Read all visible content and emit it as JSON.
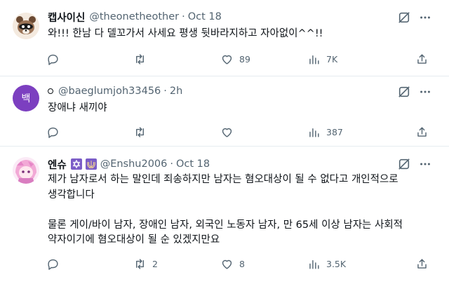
{
  "tweets": [
    {
      "name": "캡사이신",
      "handle": "@theonetheother",
      "dot": "·",
      "time": "Oct 18",
      "text": "와!!! 한남 다 델꼬가서 사세요 평생 뒷바라지하고 자아없이^^!!",
      "replies": "",
      "retweets": "",
      "likes": "89",
      "views": "7K"
    },
    {
      "name": "",
      "avatar_letter": "백",
      "avatar_color": "#7c3fc0",
      "handle": "@baeglumjoh33456",
      "dot": "·",
      "time": "2h",
      "text": "장애냐 새끼야",
      "replies": "",
      "retweets": "",
      "likes": "",
      "views": "387"
    },
    {
      "name": "엔슈",
      "handle": "@Enshu2006",
      "dot": "·",
      "time": "Oct 18",
      "text": "제가 남자로서 하는 말인데 죄송하지만 남자는 혐오대상이 될 수 없다고 개인적으로\n생각합니다\n\n물론 게이/바이 남자, 장애인 남자, 외국인 노동자 남자, 만 65세 이상 남자는 사회적\n약자이기에 혐오대상이 될 순 있겠지만요",
      "replies": "",
      "retweets": "2",
      "likes": "8",
      "views": "3.5K"
    }
  ],
  "icons": {
    "reply": "reply-icon",
    "retweet": "retweet-icon",
    "like": "like-icon",
    "views": "views-icon",
    "share": "share-icon",
    "grok": "grok-icon",
    "more": "more-icon"
  },
  "colors": {
    "text": "#0f1419",
    "secondary": "#536471",
    "divider": "#e6ecf0"
  }
}
